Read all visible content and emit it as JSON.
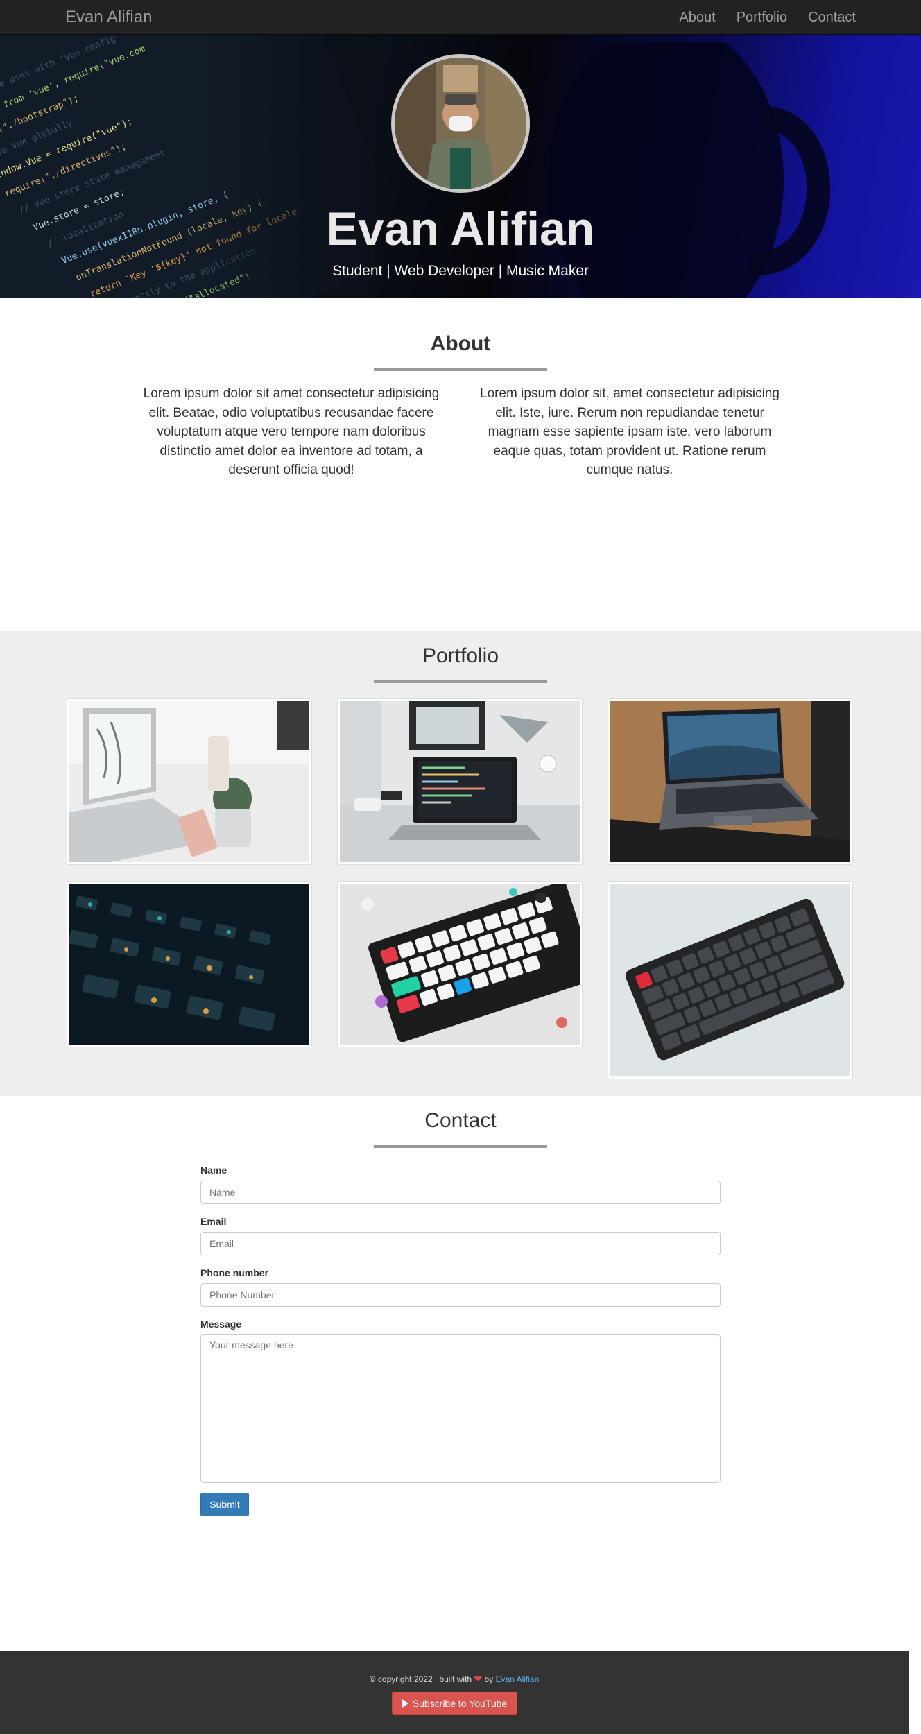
{
  "navbar": {
    "brand": "Evan Alifian",
    "links": [
      {
        "label": "About"
      },
      {
        "label": "Portfolio"
      },
      {
        "label": "Contact"
      }
    ]
  },
  "hero": {
    "name": "Evan Alifian",
    "tagline": "Student | Web Developer | Music Maker",
    "avatar_icon": "profile-photo"
  },
  "about": {
    "title": "About",
    "col1": "Lorem ipsum dolor sit amet consectetur adipisicing elit. Beatae, odio voluptatibus recusandae facere voluptatum atque vero tempore nam doloribus distinctio amet dolor ea inventore ad totam, a deserunt officia quod!",
    "col2": "Lorem ipsum dolor sit, amet consectetur adipisicing elit. Iste, iure. Rerum non repudiandae tenetur magnam esse sapiente ipsam iste, vero laborum eaque quas, totam provident ut. Ratione rerum cumque natus."
  },
  "portfolio": {
    "title": "Portfolio",
    "items": [
      {
        "icon": "laptop-white-desk-photo"
      },
      {
        "icon": "laptop-code-desk-photo"
      },
      {
        "icon": "macbook-wood-table-photo"
      },
      {
        "icon": "backlit-keyboard-photo"
      },
      {
        "icon": "mechanical-keyboard-colorful-photo"
      },
      {
        "icon": "black-keyboard-photo"
      }
    ]
  },
  "contact": {
    "title": "Contact",
    "name_label": "Name",
    "name_placeholder": "Name",
    "email_label": "Email",
    "email_placeholder": "Email",
    "phone_label": "Phone number",
    "phone_placeholder": "Phone Number",
    "message_label": "Message",
    "message_placeholder": "Your message here",
    "submit_label": "Submit"
  },
  "footer": {
    "copy_prefix": "© copyright 2022 | built with",
    "copy_by": "by",
    "author_link": "Evan Alifian",
    "subscribe_label": "Subscribe to YouTube"
  },
  "colors": {
    "navbar_bg": "#222222",
    "portfolio_bg": "#eeeeee",
    "primary_button": "#337ab7",
    "youtube_button": "#d9534f",
    "footer_bg": "#333333"
  }
}
